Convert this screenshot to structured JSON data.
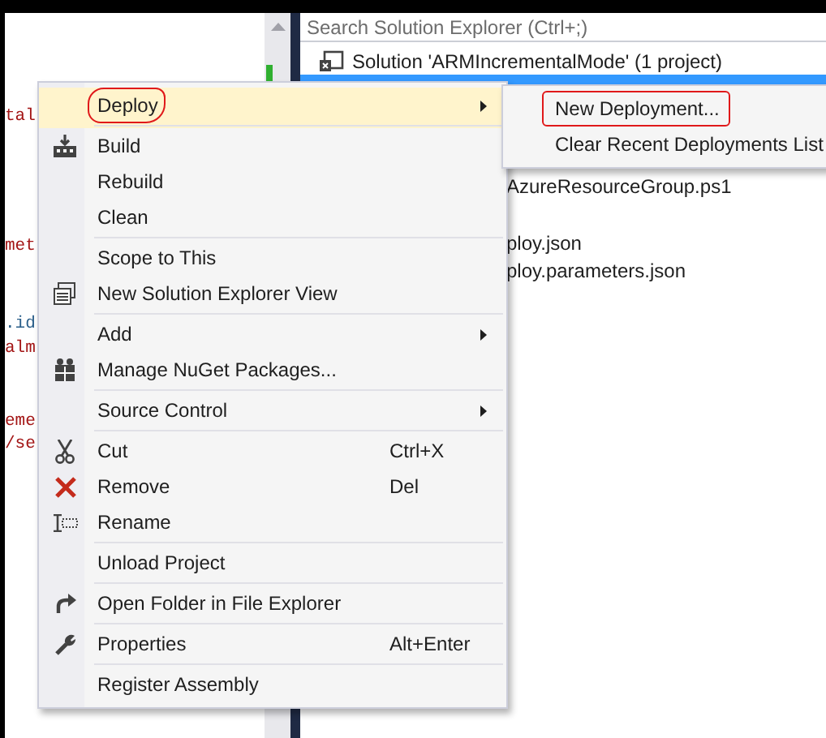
{
  "editor": {
    "code_fragments": [
      {
        "text": "tal",
        "kind": "string"
      },
      {
        "text": "met",
        "kind": "string"
      },
      {
        "text": ".id",
        "kind": "plain"
      },
      {
        "text": "alm",
        "kind": "string"
      },
      {
        "text": "eme",
        "kind": "string"
      },
      {
        "text": "/se",
        "kind": "string"
      }
    ]
  },
  "solution_explorer": {
    "search": {
      "placeholder": "Search Solution Explorer (Ctrl+;)"
    },
    "tree": [
      {
        "label": "Solution 'ARMIncrementalMode' (1 project)",
        "selected": false
      },
      {
        "selected": true
      },
      {
        "label": "AzureResourceGroup.ps1",
        "selected": false
      },
      {
        "label": "ploy.json",
        "selected": false
      },
      {
        "label": "ploy.parameters.json",
        "selected": false
      }
    ]
  },
  "context_menu": {
    "items": [
      {
        "label": "Deploy",
        "submenu": true,
        "selected": true,
        "annotated": true,
        "separator_after": true
      },
      {
        "label": "Build",
        "submenu": false,
        "selected": false,
        "annotated": false,
        "separator_after": false
      },
      {
        "label": "Rebuild",
        "submenu": false,
        "selected": false,
        "annotated": false,
        "separator_after": false
      },
      {
        "label": "Clean",
        "submenu": false,
        "selected": false,
        "annotated": false,
        "separator_after": true
      },
      {
        "label": "Scope to This",
        "submenu": false,
        "selected": false,
        "annotated": false,
        "separator_after": false
      },
      {
        "label": "New Solution Explorer View",
        "submenu": false,
        "selected": false,
        "annotated": false,
        "separator_after": true
      },
      {
        "label": "Add",
        "submenu": true,
        "selected": false,
        "annotated": false,
        "separator_after": false
      },
      {
        "label": "Manage NuGet Packages...",
        "submenu": false,
        "selected": false,
        "annotated": false,
        "separator_after": true
      },
      {
        "label": "Source Control",
        "submenu": true,
        "selected": false,
        "annotated": false,
        "separator_after": true
      },
      {
        "label": "Cut",
        "shortcut": "Ctrl+X",
        "submenu": false,
        "selected": false,
        "annotated": false,
        "separator_after": false
      },
      {
        "label": "Remove",
        "shortcut": "Del",
        "submenu": false,
        "selected": false,
        "annotated": false,
        "separator_after": false
      },
      {
        "label": "Rename",
        "submenu": false,
        "selected": false,
        "annotated": false,
        "separator_after": true
      },
      {
        "label": "Unload Project",
        "submenu": false,
        "selected": false,
        "annotated": false,
        "separator_after": true
      },
      {
        "label": "Open Folder in File Explorer",
        "submenu": false,
        "selected": false,
        "annotated": false,
        "separator_after": true
      },
      {
        "label": "Properties",
        "shortcut": "Alt+Enter",
        "submenu": false,
        "selected": false,
        "annotated": false,
        "separator_after": true
      },
      {
        "label": "Register Assembly",
        "submenu": false,
        "selected": false,
        "annotated": false,
        "separator_after": false
      }
    ]
  },
  "submenu": {
    "items": [
      {
        "label": "New Deployment...",
        "annotated": true
      },
      {
        "label": "Clear Recent Deployments List",
        "annotated": false
      }
    ]
  }
}
